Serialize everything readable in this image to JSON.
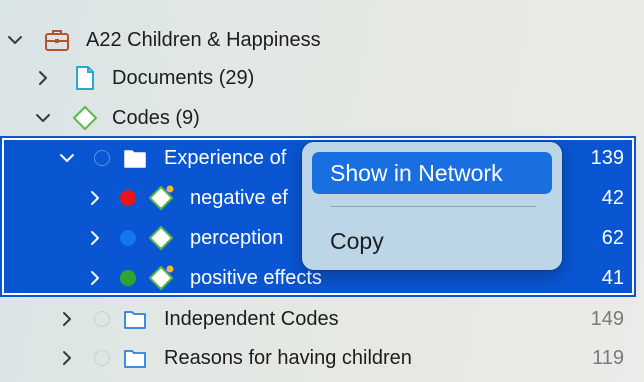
{
  "tree": {
    "project": {
      "label": "A22 Children & Happiness"
    },
    "documents": {
      "label": "Documents (29)"
    },
    "codes": {
      "label": "Codes (9)"
    },
    "groups": [
      {
        "label": "Experience of",
        "count": "139"
      },
      {
        "label": "Independent Codes",
        "count": "149"
      },
      {
        "label": "Reasons for having children",
        "count": "119"
      }
    ],
    "children": [
      {
        "label": "negative ef",
        "count": "42",
        "color": "#e8151b"
      },
      {
        "label": "perception",
        "count": "62",
        "color": "#1676f0"
      },
      {
        "label": "positive effects",
        "count": "41",
        "color": "#2ea52e"
      }
    ]
  },
  "context_menu": {
    "items": [
      {
        "label": "Show in Network",
        "highlighted": true
      },
      {
        "label": "Copy",
        "highlighted": false
      }
    ]
  },
  "colors": {
    "selection": "#0a55d2",
    "menu_highlight": "#1a6fe0",
    "project_icon": "#b5542a",
    "documents_icon": "#27a9d8",
    "codes_icon": "#5cb848"
  }
}
